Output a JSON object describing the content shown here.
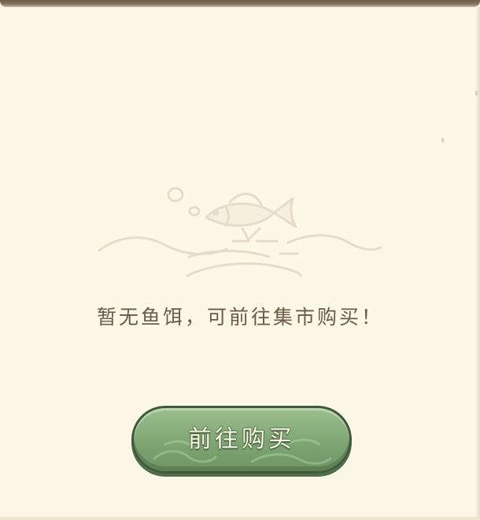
{
  "empty_state": {
    "message": "暂无鱼饵，可前往集市购买！",
    "illustration_icon": "fish-waves-icon"
  },
  "actions": {
    "goto_market_label": "前往购买"
  },
  "colors": {
    "panel_background": "#fdf7e8",
    "message_text": "#6b5a48",
    "button_fill": "#7ea572",
    "button_border": "#3f5a3b",
    "illustration_line": "#e6dccb"
  }
}
